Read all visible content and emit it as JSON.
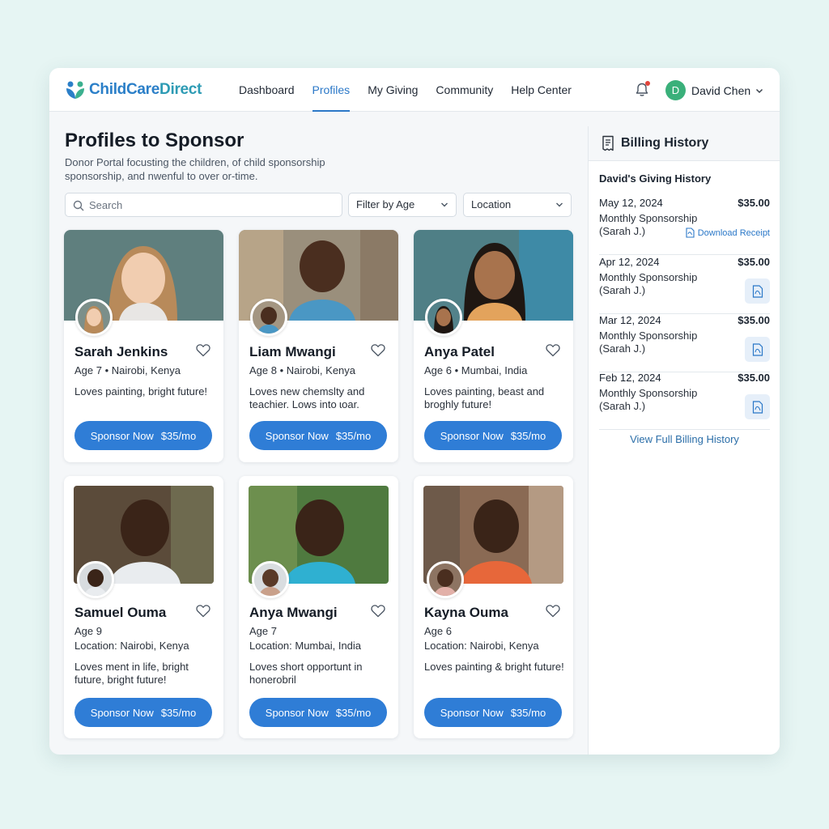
{
  "app": {
    "logo_text_1": "ChildCare",
    "logo_text_2": "Direct",
    "brand_color": "#2b7fc8",
    "accent_color": "#2f7dd6"
  },
  "nav": {
    "items": [
      {
        "label": "Dashboard",
        "active": false
      },
      {
        "label": "Profiles",
        "active": true
      },
      {
        "label": "My Giving",
        "active": false
      },
      {
        "label": "Community",
        "active": false
      },
      {
        "label": "Help Center",
        "active": false
      }
    ]
  },
  "user": {
    "initial": "D",
    "name": "David Chen"
  },
  "page": {
    "title": "Profiles to Sponsor",
    "subtitle": "Donor Portal focusting the children, of child sponsorship sponsorship, and nwenful to over or-time."
  },
  "filters": {
    "search_placeholder": "Search",
    "age_label": "Filter by Age",
    "location_label": "Location"
  },
  "profiles": [
    {
      "name": "Sarah Jenkins",
      "meta1": "Age 7 • Nairobi, Kenya",
      "meta2": "",
      "desc": "Loves painting, bright future!",
      "button": "Sponsor Now",
      "price": "$35/mo"
    },
    {
      "name": "Liam Mwangi",
      "meta1": "Age 8 • Nairobi, Kenya",
      "meta2": "",
      "desc": "Loves new chemslty and teachier. Lows into ɩoar.",
      "button": "Sponsor Now",
      "price": "$35/mo"
    },
    {
      "name": "Anya Patel",
      "meta1": "Age 6 • Mumbai, India",
      "meta2": "",
      "desc": "Loves painting, beast and broghly future!",
      "button": "Sponsor Now",
      "price": "$35/mo"
    },
    {
      "name": "Samuel Ouma",
      "meta1": "Age 9",
      "meta2": "Location: Nairobi, Kenya",
      "desc": "Loves ment in life, bright future, bright future!",
      "button": "Sponsor Now",
      "price": "$35/mo"
    },
    {
      "name": "Anya Mwangi",
      "meta1": "Age 7",
      "meta2": "Location: Mumbai, India",
      "desc": "Loves short opportunt in honerobril",
      "button": "Sponsor Now",
      "price": "$35/mo"
    },
    {
      "name": "Kayna Ouma",
      "meta1": "Age 6",
      "meta2": "Location: Nairobi, Kenya",
      "desc": "Loves painting & bright future!",
      "button": "Sponsor Now",
      "price": "$35/mo"
    }
  ],
  "billing": {
    "title": "Billing History",
    "subtitle": "David's Giving History",
    "entries": [
      {
        "date": "May 12, 2024",
        "amount": "$35.00",
        "desc": "Monthly Sponsorship (Sarah J.)",
        "action": "Download Receipt"
      },
      {
        "date": "Apr 12, 2024",
        "amount": "$35.00",
        "desc": "Monthly Sponsorship (Sarah J.)",
        "action": ""
      },
      {
        "date": "Mar 12, 2024",
        "amount": "$35.00",
        "desc": "Monthly Sponsorship (Sarah J.)",
        "action": ""
      },
      {
        "date": "Feb 12, 2024",
        "amount": "$35.00",
        "desc": "Monthly Sponsorship (Sarah J.)",
        "action": ""
      }
    ],
    "view_full": "View Full Billing History"
  }
}
